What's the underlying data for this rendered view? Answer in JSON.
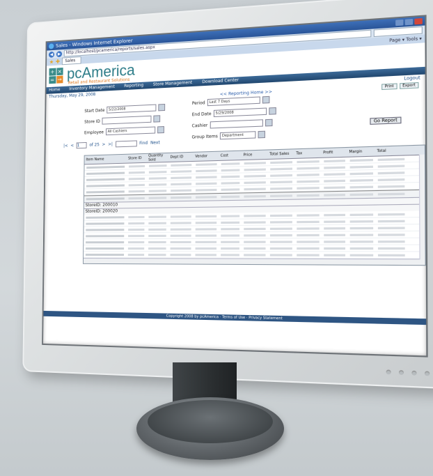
{
  "browser": {
    "title": "Sales - Windows Internet Explorer",
    "url": "http://localhost/pcamerica/reports/sales.aspx",
    "tab_label": "Sales",
    "command_bar": "Page ▾  Tools ▾"
  },
  "header": {
    "brand": "pcAmerica",
    "tagline": "Retail and Restaurant Solutions"
  },
  "menu": [
    "Home",
    "Inventory Management",
    "Reporting",
    "Store Management",
    "Download Center"
  ],
  "date_line": "Thursday, May 29, 2008",
  "logout_label": "Logout",
  "report_link": "<< Reporting Home >>",
  "toolbar": [
    "Print",
    "Export"
  ],
  "filters": {
    "start_date_label": "Start Date",
    "start_date_value": "5/22/2008",
    "store_id_label": "Store ID",
    "store_id_value": "",
    "employee_label": "Employee",
    "employee_value": "All Cashiers",
    "period_label": "Period",
    "period_value": "Last 7 Days",
    "end_date_label": "End Date",
    "end_date_value": "5/29/2008",
    "cashier_label": "Cashier",
    "cashier_value": "",
    "group_by_label": "Group Items",
    "group_by_value": "Department",
    "go_label": "Go Report"
  },
  "pager": {
    "first": "|<",
    "prev": "<",
    "page": "1",
    "of": "of 25",
    "next": ">",
    "last": ">|",
    "find": "Find",
    "next_find": "Next"
  },
  "grid": {
    "columns": [
      "Item Name",
      "Store ID",
      "Quantity Sold",
      "Dept ID",
      "Vendor",
      "Cost",
      "Price",
      "Total Sales",
      "Tax",
      "Profit",
      "Margin",
      "Total"
    ],
    "group1": "StoreID: 200010",
    "group2": "StoreID: 200020"
  },
  "footer": "Copyright 2008 by pcAmerica · Terms of Use · Privacy Statement"
}
